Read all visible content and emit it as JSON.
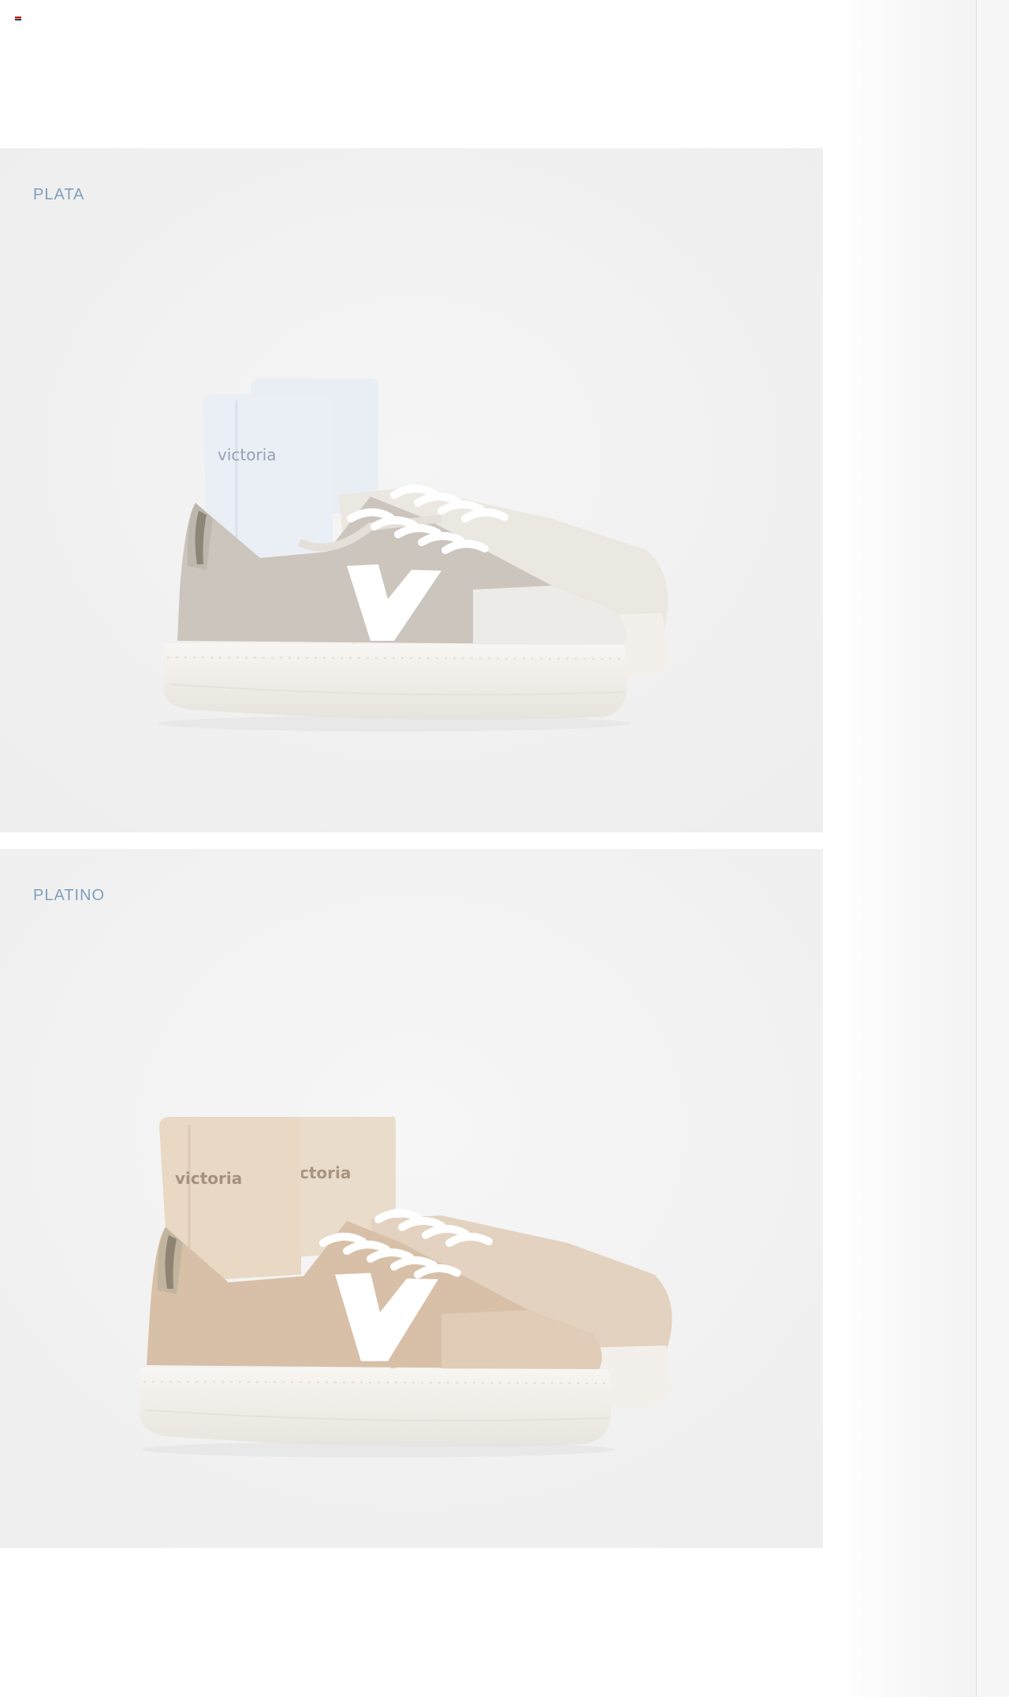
{
  "header": {
    "flag_icon": "language-flag-icon"
  },
  "products": [
    {
      "color_label": "PLATA",
      "image_name": "sneaker-silver-with-socks",
      "sock_text": "victoria",
      "colors": {
        "upper": "#cbc5bf",
        "sock": "#e6ebf2",
        "sole": "#f4f1ec",
        "accent": "#ffffff"
      }
    },
    {
      "color_label": "PLATINO",
      "image_name": "sneaker-platinum-with-socks",
      "sock_text": "victoria",
      "colors": {
        "upper": "#d6bfa6",
        "sock": "#e8d9c6",
        "sole": "#f5f2ed",
        "accent": "#ffffff"
      }
    }
  ],
  "theme": {
    "label_color": "#7f9fbb",
    "card_background": "#f1f1f1",
    "scrollbar_border": "#dedede"
  }
}
